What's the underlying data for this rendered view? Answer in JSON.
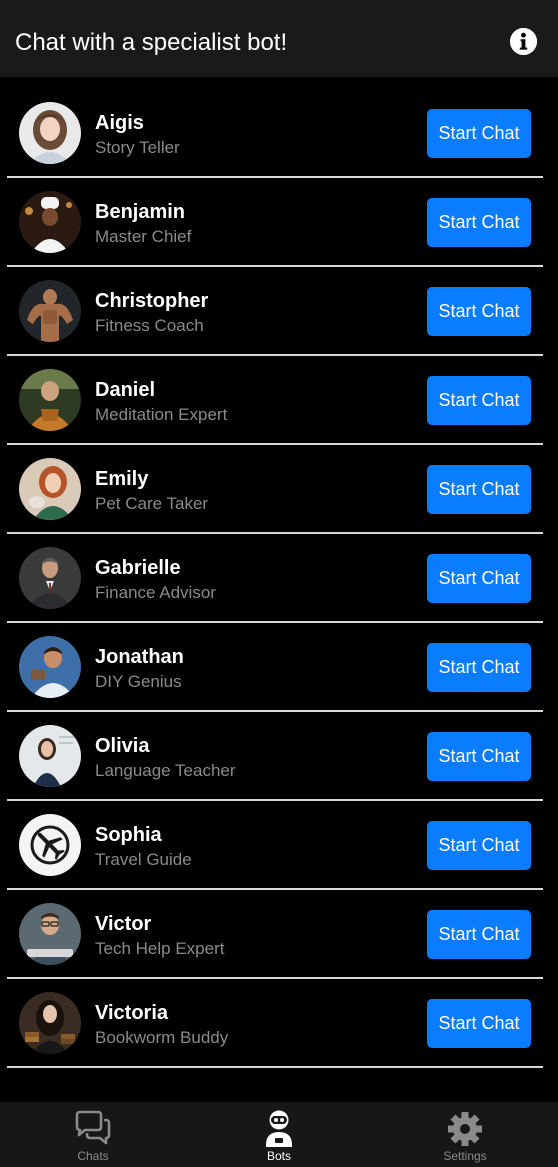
{
  "header": {
    "title": "Chat with a specialist bot!",
    "info_icon": "info-icon"
  },
  "colors": {
    "background": "#000000",
    "header_bg": "#1a1a1a",
    "accent": "#0a7cff",
    "subtitle": "#8a8a8a",
    "divider": "#d8d8d8",
    "tabbar_bg": "#171717"
  },
  "bots": [
    {
      "name": "Aigis",
      "role": "Story Teller",
      "button_label": "Start Chat",
      "avatar": "woman-portrait"
    },
    {
      "name": "Benjamin",
      "role": "Master Chief",
      "button_label": "Start Chat",
      "avatar": "chef-portrait"
    },
    {
      "name": "Christopher",
      "role": "Fitness Coach",
      "button_label": "Start Chat",
      "avatar": "bodybuilder-portrait"
    },
    {
      "name": "Daniel",
      "role": "Meditation Expert",
      "button_label": "Start Chat",
      "avatar": "monk-portrait"
    },
    {
      "name": "Emily",
      "role": "Pet Care Taker",
      "button_label": "Start Chat",
      "avatar": "woman-with-pet-portrait"
    },
    {
      "name": "Gabrielle",
      "role": "Finance Advisor",
      "button_label": "Start Chat",
      "avatar": "businessman-portrait"
    },
    {
      "name": "Jonathan",
      "role": "DIY Genius",
      "button_label": "Start Chat",
      "avatar": "man-portrait"
    },
    {
      "name": "Olivia",
      "role": "Language Teacher",
      "button_label": "Start Chat",
      "avatar": "teacher-portrait"
    },
    {
      "name": "Sophia",
      "role": "Travel Guide",
      "button_label": "Start Chat",
      "avatar": "airplane-icon"
    },
    {
      "name": "Victor",
      "role": "Tech Help Expert",
      "button_label": "Start Chat",
      "avatar": "man-with-glasses-portrait"
    },
    {
      "name": "Victoria",
      "role": "Bookworm Buddy",
      "button_label": "Start Chat",
      "avatar": "woman-with-books-portrait"
    }
  ],
  "tabbar": {
    "tabs": [
      {
        "label": "Chats",
        "icon": "chat-bubbles-icon",
        "active": false
      },
      {
        "label": "Bots",
        "icon": "robot-icon",
        "active": true
      },
      {
        "label": "Settings",
        "icon": "gear-icon",
        "active": false
      }
    ]
  }
}
